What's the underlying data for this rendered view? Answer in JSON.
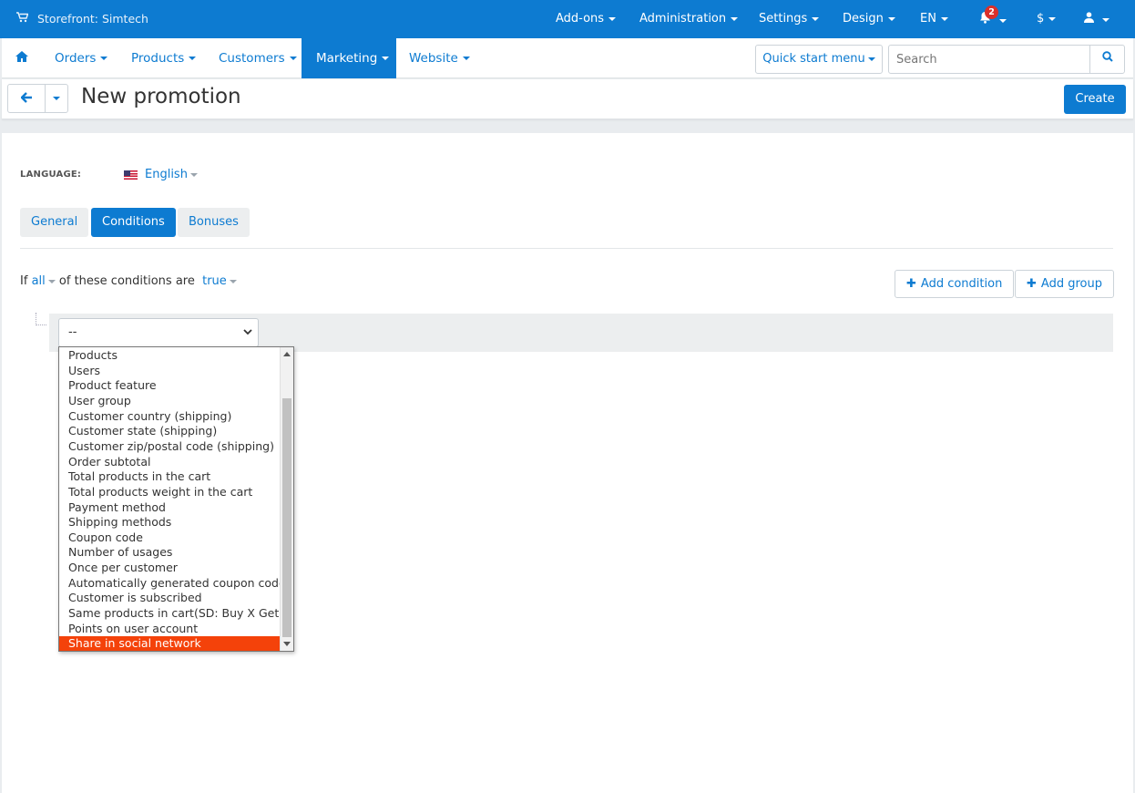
{
  "topbar": {
    "store_label": "Storefront: Simtech",
    "menus": [
      "Add-ons",
      "Administration",
      "Settings",
      "Design",
      "EN"
    ],
    "notification_count": "2",
    "currency": "$"
  },
  "navbar": {
    "items": [
      "Orders",
      "Products",
      "Customers",
      "Marketing",
      "Website"
    ],
    "active": "Marketing",
    "quick_start": "Quick start menu",
    "search_placeholder": "Search"
  },
  "page": {
    "title": "New promotion",
    "create_label": "Create"
  },
  "language": {
    "label": "LANGUAGE:",
    "value": "English"
  },
  "tabs": [
    "General",
    "Conditions",
    "Bonuses"
  ],
  "active_tab": "Conditions",
  "conditions": {
    "prefix": "If",
    "mode": "all",
    "middle": "of these conditions are",
    "value": "true",
    "add_condition": "Add condition",
    "add_group": "Add group",
    "select_value": "--"
  },
  "dropdown": {
    "options": [
      "Products",
      "Users",
      "Product feature",
      "User group",
      "Customer country (shipping)",
      "Customer state (shipping)",
      "Customer zip/postal code (shipping)",
      "Order subtotal",
      "Total products in the cart",
      "Total products weight in the cart",
      "Payment method",
      "Shipping methods",
      "Coupon code",
      "Number of usages",
      "Once per customer",
      "Automatically generated coupon codes",
      "Customer is subscribed",
      "Same products in cart(SD: Buy X Get Y)",
      "Points on user account",
      "Share in social network"
    ],
    "selected": "Share in social network"
  },
  "colors": {
    "brand_blue": "#0d7bd1",
    "highlight": "#f4420a",
    "badge_red": "#d9302b"
  },
  "icons": [
    "cart-icon",
    "bell-icon",
    "user-icon",
    "home-icon",
    "search-icon",
    "arrow-left-icon",
    "plus-icon",
    "flag-us-icon"
  ]
}
